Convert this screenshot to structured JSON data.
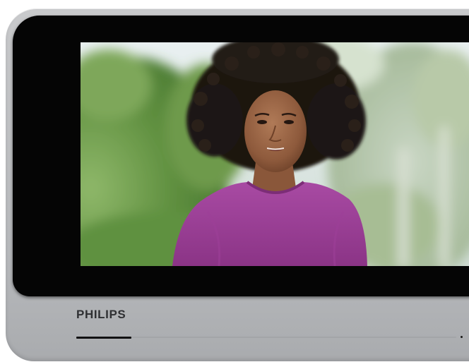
{
  "device": {
    "brand_label": "PHILIPS",
    "screen_image": "video-call-woman-curly-hair-purple-top"
  },
  "progress": {
    "fraction": 0.145
  },
  "colors": {
    "bezel": "#050505",
    "housing": "#bfc1c4",
    "brand_text": "#2f3033",
    "shirt": "#9a3e95"
  }
}
